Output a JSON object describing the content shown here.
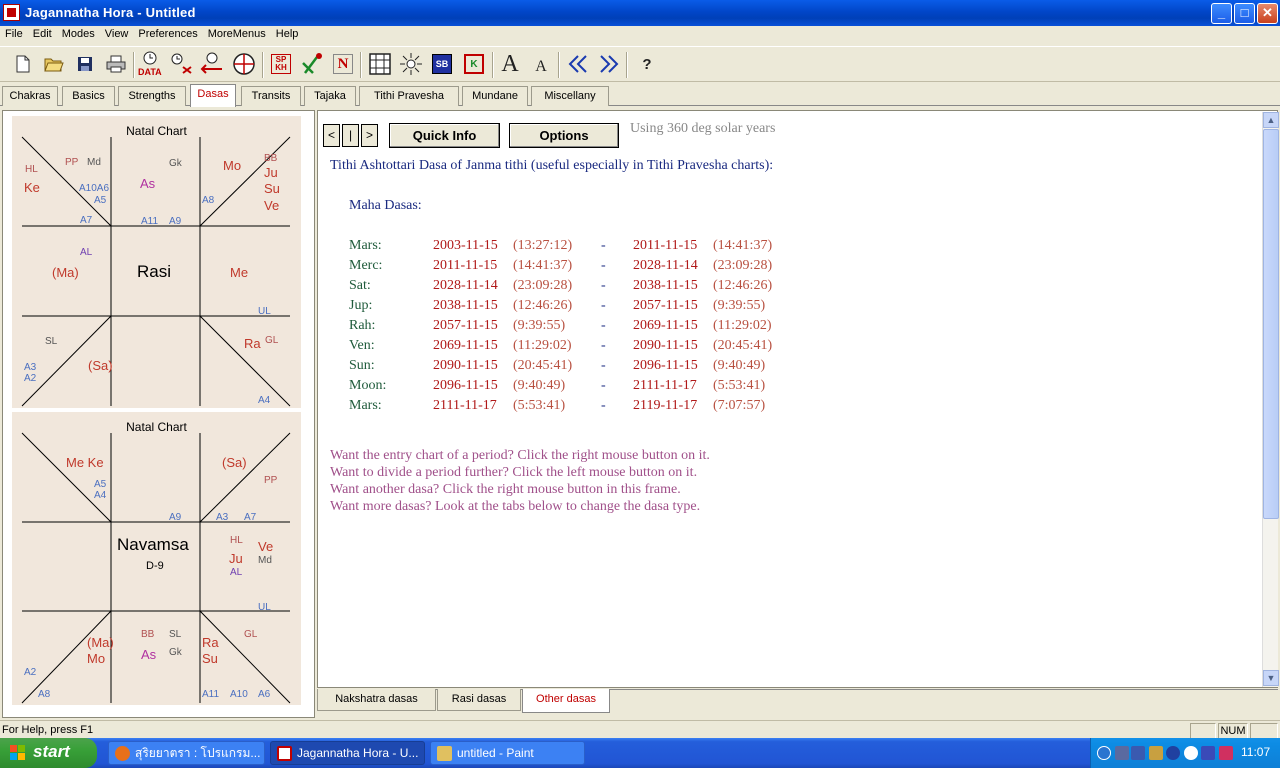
{
  "window": {
    "title": "Jagannatha Hora - Untitled"
  },
  "menu": [
    "File",
    "Edit",
    "Modes",
    "View",
    "Preferences",
    "MoreMenus",
    "Help"
  ],
  "toolbar": {
    "data_label": "DATA",
    "spkh_label": "SP\nKH",
    "n_label": "N",
    "sb_label": "SB",
    "k_label": "K",
    "font_big": "A",
    "font_small": "A",
    "help_label": "?"
  },
  "tabs_top": [
    "Chakras",
    "Basics",
    "Strengths",
    "Dasas",
    "Transits",
    "Tajaka",
    "Tithi Pravesha",
    "Mundane",
    "Miscellany"
  ],
  "tabs_top_active": "Dasas",
  "rasi_chart": {
    "title": "Natal Chart",
    "center_name": "Rasi",
    "labels": {
      "HL": "HL",
      "Ke": "Ke",
      "PP": "PP",
      "Md": "Md",
      "A10A6": "A10A6",
      "A5": "A5",
      "A7": "A7",
      "As": "As",
      "Gk": "Gk",
      "A11": "A11",
      "A9": "A9",
      "Mo": "Mo",
      "BB": "BB",
      "Ju": "Ju",
      "Su": "Su",
      "Ve": "Ve",
      "A8": "A8",
      "AL": "AL",
      "Ma": "(Ma)",
      "Me": "Me",
      "UL": "UL",
      "SL": "SL",
      "A3": "A3",
      "A2": "A2",
      "Sa": "(Sa)",
      "Ra": "Ra",
      "GL": "GL",
      "A4": "A4"
    }
  },
  "navamsa_chart": {
    "title": "Natal Chart",
    "center_name": "Navamsa",
    "center_sub": "D-9",
    "labels": {
      "MeKe": "Me Ke",
      "A5": "A5",
      "A4": "A4",
      "A9": "A9",
      "Sa": "(Sa)",
      "PP": "PP",
      "A3": "A3",
      "A7": "A7",
      "HL": "HL",
      "Ve": "Ve",
      "Ju": "Ju",
      "Md": "Md",
      "AL": "AL",
      "UL": "UL",
      "Ma": "(Ma)",
      "Mo": "Mo",
      "BB": "BB",
      "SL": "SL",
      "As": "As",
      "Gk": "Gk",
      "A2": "A2",
      "A8": "A8",
      "Ra": "Ra",
      "Su": "Su",
      "GL": "GL",
      "A11": "A11",
      "A10": "A10",
      "A6": "A6"
    }
  },
  "dasa": {
    "nav_prev": "<",
    "nav_mid": "|",
    "nav_next": ">",
    "quick_info": "Quick Info",
    "options": "Options",
    "solar_note": "Using 360 deg solar years",
    "heading": "Tithi Ashtottari Dasa of Janma tithi (useful especially in Tithi Pravesha charts):",
    "maha_label": "Maha Dasas:",
    "rows": [
      {
        "planet": "Mars:",
        "start_date": "2003-11-15",
        "start_time": "(13:27:12)",
        "dash": "-",
        "end_date": "2011-11-15",
        "end_time": "(14:41:37)"
      },
      {
        "planet": "Merc:",
        "start_date": "2011-11-15",
        "start_time": "(14:41:37)",
        "dash": "-",
        "end_date": "2028-11-14",
        "end_time": "(23:09:28)"
      },
      {
        "planet": "Sat:",
        "start_date": "2028-11-14",
        "start_time": "(23:09:28)",
        "dash": "-",
        "end_date": "2038-11-15",
        "end_time": "(12:46:26)"
      },
      {
        "planet": "Jup:",
        "start_date": "2038-11-15",
        "start_time": "(12:46:26)",
        "dash": "-",
        "end_date": "2057-11-15",
        "end_time": "(9:39:55)"
      },
      {
        "planet": "Rah:",
        "start_date": "2057-11-15",
        "start_time": "(9:39:55)",
        "dash": "-",
        "end_date": "2069-11-15",
        "end_time": "(11:29:02)"
      },
      {
        "planet": "Ven:",
        "start_date": "2069-11-15",
        "start_time": "(11:29:02)",
        "dash": "-",
        "end_date": "2090-11-15",
        "end_time": "(20:45:41)"
      },
      {
        "planet": "Sun:",
        "start_date": "2090-11-15",
        "start_time": "(20:45:41)",
        "dash": "-",
        "end_date": "2096-11-15",
        "end_time": "(9:40:49)"
      },
      {
        "planet": "Moon:",
        "start_date": "2096-11-15",
        "start_time": "(9:40:49)",
        "dash": "-",
        "end_date": "2111-11-17",
        "end_time": "(5:53:41)"
      },
      {
        "planet": "Mars:",
        "start_date": "2111-11-17",
        "start_time": "(5:53:41)",
        "dash": "-",
        "end_date": "2119-11-17",
        "end_time": "(7:07:57)"
      }
    ],
    "help_lines": [
      "Want the entry chart of a period? Click the right mouse button on it.",
      "Want to divide a period further? Click the left mouse button on it.",
      "Want another dasa? Click the right mouse button in this frame.",
      "Want more dasas? Look at the tabs below to change the dasa type."
    ]
  },
  "tabs_bottom": [
    "Nakshatra dasas",
    "Rasi dasas",
    "Other dasas"
  ],
  "tabs_bottom_active": "Other dasas",
  "status": {
    "message": "For Help, press F1",
    "num": "NUM"
  },
  "taskbar": {
    "start": "start",
    "tasks": [
      "สุริยยาตรา : โปรแกรม...",
      "Jagannatha Hora - U...",
      "untitled - Paint"
    ],
    "clock": "11:07"
  },
  "colors": {
    "titlebar": "#0146c8",
    "active_tab_text": "#c00000",
    "planet_red": "#c0392b",
    "aspect_blue": "#4a6fc0",
    "purple": "#b030a0",
    "chart_bg": "#f1e7dc"
  }
}
